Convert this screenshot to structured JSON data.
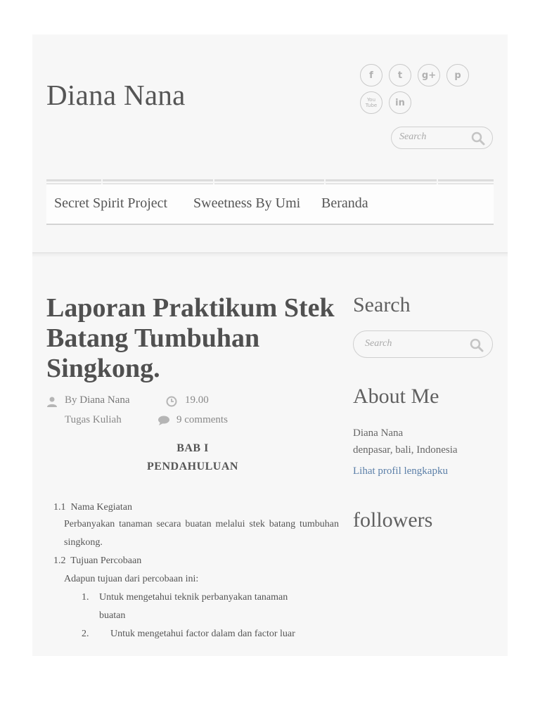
{
  "header": {
    "site_title": "Diana Nana",
    "social_icons": [
      "facebook-icon",
      "twitter-icon",
      "google-plus-icon",
      "pinterest-icon",
      "youtube-icon",
      "linkedin-icon"
    ],
    "social_glyphs": {
      "facebook": "f",
      "twitter": "t",
      "google_plus": "g+",
      "pinterest": "p",
      "youtube_line1": "You",
      "youtube_line2": "Tube",
      "linkedin": "in"
    },
    "search_placeholder": "Search"
  },
  "nav": {
    "items": [
      {
        "label": "Secret Spirit Project"
      },
      {
        "label": "Sweetness By Umi"
      },
      {
        "label": "Beranda"
      }
    ]
  },
  "post": {
    "title": "Laporan Praktikum Stek Batang Tumbuhan Singkong.",
    "author_prefix": "By",
    "author": "Diana Nana",
    "time": "19.00",
    "label": "Tugas Kuliah",
    "comments": "9 comments",
    "heading1": "BAB I",
    "heading2": "PENDAHULUAN",
    "s1_num": "1.1",
    "s1_title": "Nama Kegiatan",
    "s1_text": "Perbanyakan tanaman secara buatan melalui stek batang tumbuhan singkong.",
    "s2_num": "1.2",
    "s2_title": "Tujuan Percobaan",
    "s2_intro": "Adapun tujuan dari percobaan ini:",
    "goal1_num": "1.",
    "goal1_line1": "Untuk mengetahui teknik perbanyakan tanaman",
    "goal1_line2": "buatan",
    "goal2_num": "2.",
    "goal2_line1": "Untuk mengetahui factor dalam dan factor luar"
  },
  "sidebar": {
    "search_heading": "Search",
    "search_placeholder": "Search",
    "about_heading": "About Me",
    "about_name": "Diana Nana",
    "about_location": "denpasar, bali, Indonesia",
    "about_link": "Lihat profil lengkapku",
    "followers_heading": "followers"
  },
  "colors": {
    "page_bg": "#f7f7f7",
    "text": "#555555",
    "link": "#5b7fa8"
  }
}
